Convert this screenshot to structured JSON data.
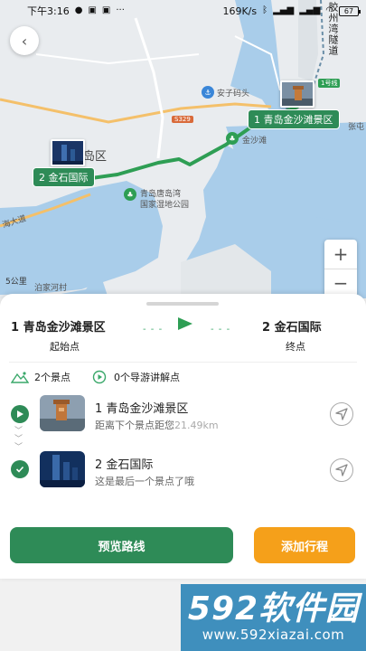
{
  "status_bar": {
    "time": "下午3:16",
    "net_speed": "169K/s",
    "battery": "67"
  },
  "map": {
    "labels": {
      "district": "岛区",
      "pier": "安子码头",
      "jinshatan": "金沙滩",
      "wetland_line1": "青岛唐岛湾",
      "wetland_line2": "国家湿地公园",
      "road": "海大道",
      "tunnel": "胶州湾隧道",
      "river": "泊家河村",
      "zhang": "张屯",
      "road_s329": "S329",
      "road_top": "1号线"
    },
    "markers": [
      {
        "label": "1 青岛金沙滩景区"
      },
      {
        "label": "2 金石国际"
      }
    ],
    "scale": "5公里",
    "zoom_in": "+",
    "zoom_out": "−"
  },
  "route": {
    "start_name": "1 青岛金沙滩景区",
    "start_sub": "起始点",
    "end_name": "2 金石国际",
    "end_sub": "终点",
    "dash_left": "- - -",
    "dash_right": "- - -"
  },
  "counts": {
    "spots": "2个景点",
    "guides": "0个导游讲解点"
  },
  "spots": [
    {
      "name": "1 青岛金沙滩景区",
      "desc": "距离下个景点距您",
      "distance": "21.49km"
    },
    {
      "name": "2 金石国际",
      "desc": "这是最后一个景点了哦",
      "distance": ""
    }
  ],
  "actions": {
    "preview": "预览路线",
    "add": "添加行程"
  },
  "watermark": {
    "logo_num": "592",
    "logo_text": "软件园",
    "url": "www.592xiazai.com"
  },
  "colors": {
    "primary": "#2e8b57",
    "accent": "#f5a01a",
    "water": "#a9cdea",
    "land": "#eceff1"
  }
}
